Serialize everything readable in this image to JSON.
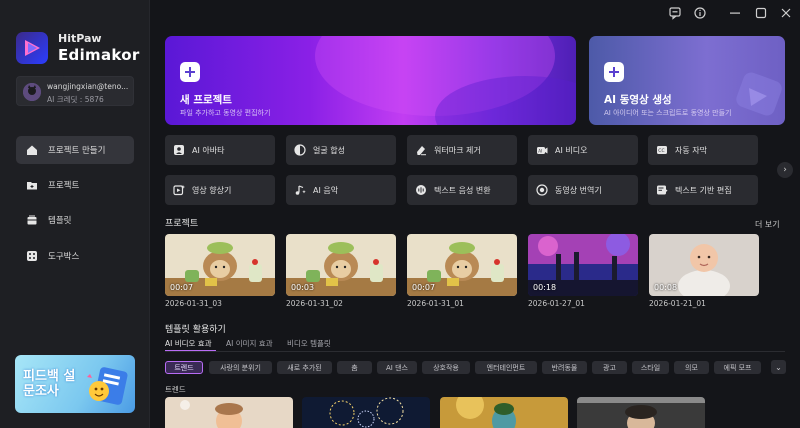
{
  "window": {
    "icons": [
      "feedback-icon",
      "info-icon",
      "minimize-icon",
      "maximize-icon",
      "close-icon"
    ]
  },
  "brand": {
    "line1": "HitPaw",
    "line2": "Edimakor"
  },
  "account": {
    "email": "wangjingxian@teno...",
    "credits": "AI 크레딧 : 5876"
  },
  "sidebar": {
    "items": [
      {
        "label": "프로젝트 만들기",
        "icon": "home-icon",
        "active": true
      },
      {
        "label": "프로젝트",
        "icon": "folder-icon",
        "active": false
      },
      {
        "label": "템플릿",
        "icon": "template-icon",
        "active": false
      },
      {
        "label": "도구박스",
        "icon": "toolbox-icon",
        "active": false
      }
    ],
    "promo": {
      "text": "피드백 설문조사"
    }
  },
  "hero": {
    "new_project": {
      "title": "새 프로젝트",
      "subtitle": "파일 추가하고 동영상 편집하기"
    },
    "ai_video": {
      "title": "AI 동영상 생성",
      "subtitle": "AI 아이디어 또는 스크립트로 동영상 만들기"
    }
  },
  "tools": [
    {
      "label": "AI 아바타",
      "icon": "avatar-icon"
    },
    {
      "label": "얼굴 합성",
      "icon": "face-swap-icon"
    },
    {
      "label": "워터마크 제거",
      "icon": "eraser-icon"
    },
    {
      "label": "AI 비디오",
      "icon": "ai-video-icon"
    },
    {
      "label": "자동 자막",
      "icon": "subtitle-icon"
    },
    {
      "label": "영상 향상기",
      "icon": "enhance-icon"
    },
    {
      "label": "AI 음악",
      "icon": "music-icon"
    },
    {
      "label": "텍스트 음성 변환",
      "icon": "tts-icon"
    },
    {
      "label": "동영상 번역기",
      "icon": "translate-icon"
    },
    {
      "label": "텍스트 기반 편집",
      "icon": "text-edit-icon"
    }
  ],
  "projects": {
    "heading": "프로젝트",
    "more": "더 보기",
    "items": [
      {
        "name": "2026-01-31_03",
        "duration": "00:07"
      },
      {
        "name": "2026-01-31_02",
        "duration": "00:03"
      },
      {
        "name": "2026-01-31_01",
        "duration": "00:07"
      },
      {
        "name": "2026-01-27_01",
        "duration": "00:18"
      },
      {
        "name": "2026-01-21_01",
        "duration": "00:08"
      }
    ]
  },
  "templates": {
    "heading": "템플릿 활용하기",
    "tabs": [
      "AI 비디오 효과",
      "AI 이미지 효과",
      "비디오 템플릿"
    ],
    "active_tab": 0,
    "chips": [
      "트렌드",
      "사랑의 분위기",
      "새로 추가된",
      "춤",
      "AI 댄스",
      "상호작용",
      "엔터테인먼트",
      "반려동물",
      "광고",
      "스타일",
      "의모",
      "에픽 모프"
    ],
    "active_chip": 0,
    "trend_heading": "트렌드"
  },
  "colors": {
    "accent": "#b86cf5",
    "background": "#141519",
    "sidebar": "#1e1f23",
    "card": "#2a2b30"
  }
}
